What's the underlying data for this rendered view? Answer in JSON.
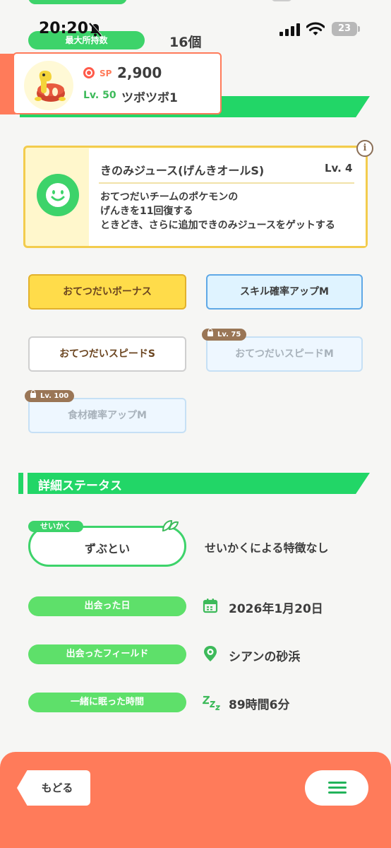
{
  "status_bar": {
    "time": "20:20",
    "battery": "23"
  },
  "storage": {
    "max_label": "最大所持数",
    "value": "16個"
  },
  "pokemon": {
    "sp_label": "SP",
    "sp_value": "2,900",
    "level": "Lv. 50",
    "name": "ツボツボ1"
  },
  "main_skill": {
    "name": "きのみジュース(げんきオールS)",
    "level": "Lv. 4",
    "description": "おてつだいチームのポケモンの\nげんきを11回復する\nときどき、さらに追加できのみジュースをゲットする",
    "info_label": "i"
  },
  "sub_skills": [
    {
      "label": "おてつだいボーナス",
      "lock": ""
    },
    {
      "label": "スキル確率アップM",
      "lock": ""
    },
    {
      "label": "おてつだいスピードS",
      "lock": ""
    },
    {
      "label": "おてつだいスピードM",
      "lock": "Lv. 75"
    },
    {
      "label": "食材確率アップM",
      "lock": "Lv. 100"
    }
  ],
  "details": {
    "title": "詳細ステータス",
    "nature_tag": "せいかく",
    "nature": "ずぶとい",
    "nature_effect": "せいかくによる特徴なし",
    "met_date_label": "出会った日",
    "met_date": "2026年1月20日",
    "met_field_label": "出会ったフィールド",
    "met_field": "シアンの砂浜",
    "sleep_label": "一緒に眠った時間",
    "sleep_time": "89時間6分"
  },
  "footer": {
    "back_label": "もどる"
  },
  "colors": {
    "accent_green": "#22d667",
    "footer_orange": "#ff7b5a",
    "gold": "#ffdc4a"
  }
}
